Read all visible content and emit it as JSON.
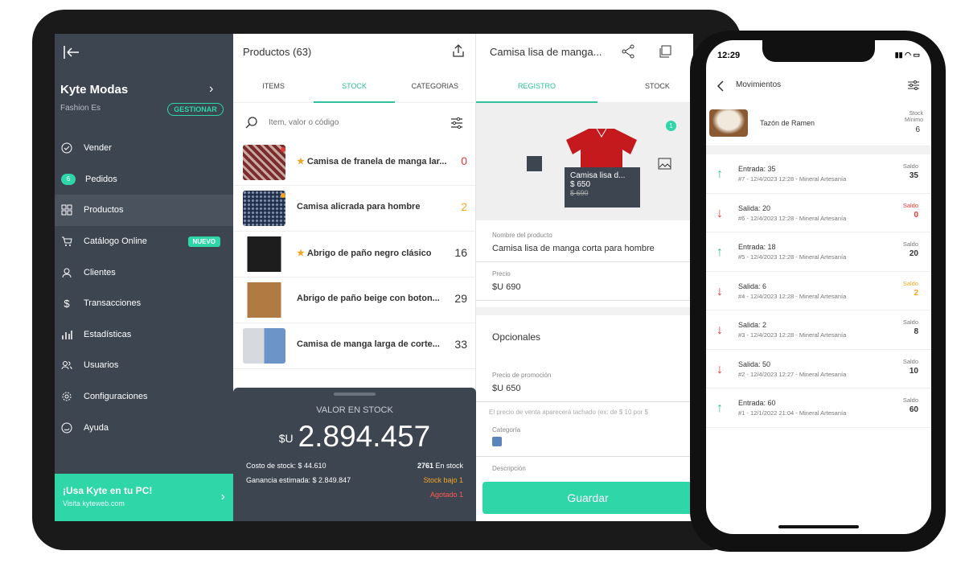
{
  "colors": {
    "accent": "#2fd6a8",
    "sidebar": "#3d4551",
    "danger": "#e53935",
    "warning": "#f4a623"
  },
  "sidebar": {
    "brand": "Kyte Modas",
    "subtitle": "Fashion Es",
    "manage_label": "GESTIONAR",
    "items": [
      {
        "label": "Vender",
        "icon": "check-circle-icon"
      },
      {
        "label": "Pedidos",
        "icon": "badge",
        "badge": "6"
      },
      {
        "label": "Productos",
        "icon": "grid-icon"
      },
      {
        "label": "Catálogo Online",
        "icon": "cart-icon",
        "tag": "NUEVO"
      },
      {
        "label": "Clientes",
        "icon": "user-icon"
      },
      {
        "label": "Transacciones",
        "icon": "dollar-icon"
      },
      {
        "label": "Estadísticas",
        "icon": "bar-chart-icon"
      },
      {
        "label": "Usuarios",
        "icon": "users-icon"
      },
      {
        "label": "Configuraciones",
        "icon": "gear-icon"
      },
      {
        "label": "Ayuda",
        "icon": "help-icon"
      }
    ],
    "promo": {
      "title": "¡Usa Kyte en tu PC!",
      "subtitle": "Visita kyteweb.com"
    }
  },
  "products": {
    "title": "Productos (63)",
    "tabs": [
      "ITEMS",
      "STOCK",
      "CATEGORIAS"
    ],
    "search_placeholder": "Item, valor o código",
    "rows": [
      {
        "name": "Camisa de franela de manga lar...",
        "qty": "0",
        "starred": true,
        "dot": "#e53935",
        "qty_color": "#e53935"
      },
      {
        "name": "Camisa alicrada para hombre",
        "qty": "2",
        "starred": false,
        "dot": "#f4a623",
        "qty_color": "#f4a623"
      },
      {
        "name": "Abrigo de paño negro clásico",
        "qty": "16",
        "starred": true,
        "dot": "",
        "qty_color": "#333"
      },
      {
        "name": "Abrigo de paño beige con boton...",
        "qty": "29",
        "starred": false,
        "dot": "",
        "qty_color": "#333"
      },
      {
        "name": "Camisa de manga larga de corte...",
        "qty": "33",
        "starred": false,
        "dot": "",
        "qty_color": "#333"
      }
    ],
    "stock": {
      "label": "VALOR EN STOCK",
      "currency": "$U",
      "value": "2.894.457",
      "cost": "Costo de stock: $ 44.610",
      "profit": "Ganancia estimada: $ 2.849.847",
      "units_count": "2761",
      "units_label": "En stock",
      "low": "Stock bajo 1",
      "out": "Agotado 1"
    }
  },
  "detail": {
    "title": "Camisa lisa de manga...",
    "tabs": [
      "REGISTRO",
      "STOCK"
    ],
    "tooltip": {
      "name": "Camisa lisa d...",
      "price": "$ 650",
      "old_price": "$ 690"
    },
    "image_count": "1",
    "fields": {
      "name_label": "Nombre del producto",
      "name_value": "Camisa lisa de manga corta para hombre",
      "price_label": "Precio",
      "price_value": "$U 690",
      "optional_title": "Opcionales",
      "promo_label": "Precio de promoción",
      "promo_value": "$U 650",
      "promo_hint": "El precio de venta aparecerá tachado (ex: de $ 10 por $",
      "category_label": "Categoría",
      "description_label": "Descripción"
    },
    "save_label": "Guardar"
  },
  "phone": {
    "time": "12:29",
    "title": "Movimientos",
    "product": {
      "name": "Tazón de Ramen",
      "min_label": "Stock\nMínimo",
      "min_value": "6"
    },
    "movements": [
      {
        "type": "in",
        "title": "Entrada: 35",
        "sub": "#7 - 12/4/2023 12:28 - Mineral Artesanía",
        "saldo_label": "Saldo",
        "saldo": "35",
        "color": "#333"
      },
      {
        "type": "out",
        "title": "Salida: 20",
        "sub": "#6 - 12/4/2023 12:28 - Mineral Artesanía",
        "saldo_label": "Saldo",
        "saldo": "0",
        "color": "#e53935"
      },
      {
        "type": "in",
        "title": "Entrada: 18",
        "sub": "#5 - 12/4/2023 12:28 - Mineral Artesanía",
        "saldo_label": "Saldo",
        "saldo": "20",
        "color": "#333"
      },
      {
        "type": "out",
        "title": "Salida: 6",
        "sub": "#4 - 12/4/2023 12:28 - Mineral Artesanía",
        "saldo_label": "Saldo",
        "saldo": "2",
        "color": "#f4a623"
      },
      {
        "type": "out",
        "title": "Salida: 2",
        "sub": "#3 - 12/4/2023 12:28 - Mineral Artesanía",
        "saldo_label": "Saldo",
        "saldo": "8",
        "color": "#333"
      },
      {
        "type": "out",
        "title": "Salida: 50",
        "sub": "#2 - 12/4/2023 12:27 - Mineral Artesanía",
        "saldo_label": "Saldo",
        "saldo": "10",
        "color": "#333"
      },
      {
        "type": "in",
        "title": "Entrada: 60",
        "sub": "#1 - 12/1/2022 21:04 - Mineral Artesanía",
        "saldo_label": "Saldo",
        "saldo": "60",
        "color": "#333"
      }
    ]
  }
}
